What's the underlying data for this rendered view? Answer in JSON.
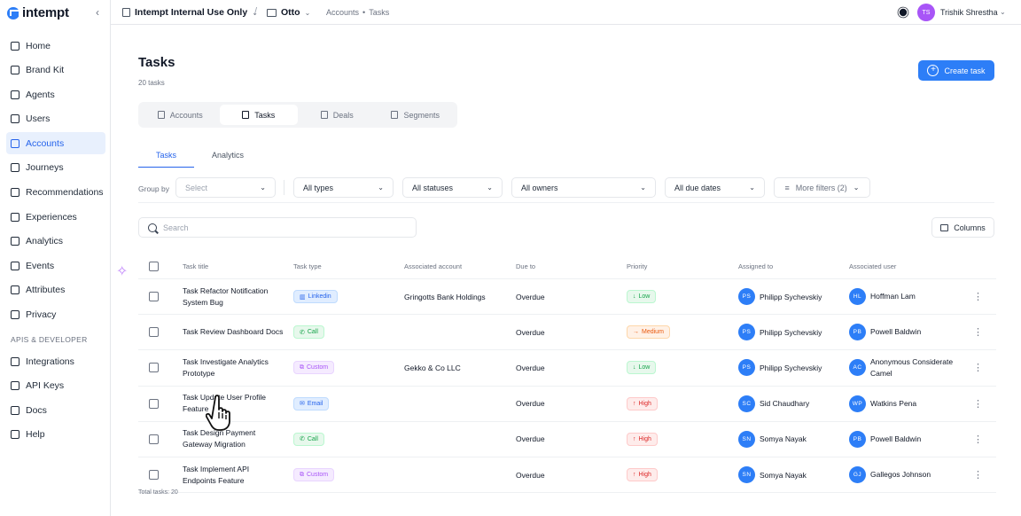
{
  "brand": {
    "name": "intempt"
  },
  "nav": {
    "items": [
      {
        "label": "Home",
        "icon": "home-icon",
        "active": false
      },
      {
        "label": "Brand Kit",
        "icon": "brand-kit-icon",
        "active": false
      },
      {
        "label": "Agents",
        "icon": "agents-icon",
        "active": false
      },
      {
        "label": "Users",
        "icon": "users-icon",
        "active": false
      },
      {
        "label": "Accounts",
        "icon": "accounts-icon",
        "active": true
      },
      {
        "label": "Journeys",
        "icon": "journeys-icon",
        "active": false
      },
      {
        "label": "Recommendations",
        "icon": "recommendations-icon",
        "active": false
      },
      {
        "label": "Experiences",
        "icon": "experiences-icon",
        "active": false
      },
      {
        "label": "Analytics",
        "icon": "analytics-icon",
        "active": false
      },
      {
        "label": "Events",
        "icon": "events-icon",
        "active": false
      },
      {
        "label": "Attributes",
        "icon": "attributes-icon",
        "active": false
      },
      {
        "label": "Privacy",
        "icon": "privacy-icon",
        "active": false
      }
    ],
    "section_label": "APIS & DEVELOPER",
    "dev_items": [
      {
        "label": "Integrations",
        "icon": "integrations-icon"
      },
      {
        "label": "API Keys",
        "icon": "api-keys-icon"
      },
      {
        "label": "Docs",
        "icon": "docs-icon"
      },
      {
        "label": "Help",
        "icon": "help-icon"
      }
    ]
  },
  "topbar": {
    "workspace": "Intempt Internal Use Only",
    "project": "Otto",
    "path": [
      "Accounts",
      "Tasks"
    ],
    "user": {
      "initials": "TS",
      "name": "Trishik Shrestha"
    }
  },
  "page": {
    "title": "Tasks",
    "subtitle": "20 tasks",
    "create_label": "Create task"
  },
  "segments": [
    {
      "label": "Accounts",
      "active": false
    },
    {
      "label": "Tasks",
      "active": true
    },
    {
      "label": "Deals",
      "active": false
    },
    {
      "label": "Segments",
      "active": false
    }
  ],
  "subtabs": [
    {
      "label": "Tasks",
      "active": true
    },
    {
      "label": "Analytics",
      "active": false
    }
  ],
  "filters": {
    "group_by_label": "Group by",
    "group_by_placeholder": "Select",
    "types": "All types",
    "statuses": "All statuses",
    "owners": "All owners",
    "due_dates": "All due dates",
    "more_filters": "More filters (2)"
  },
  "search": {
    "placeholder": "Search"
  },
  "columns_label": "Columns",
  "table": {
    "headers": [
      "Task title",
      "Task type",
      "Associated account",
      "Due to",
      "Priority",
      "Assigned to",
      "Associated user"
    ],
    "rows": [
      {
        "title": "Task Refactor Notification System Bug",
        "type": "Linkedin",
        "type_key": "linkedin",
        "account": "Gringotts Bank Holdings",
        "due": "Overdue",
        "priority": "Low",
        "priority_key": "low",
        "assignee_initials": "PS",
        "assignee": "Philipp Sychevskiy",
        "user_initials": "HL",
        "user": "Hoffman Lam"
      },
      {
        "title": "Task Review Dashboard Docs",
        "type": "Call",
        "type_key": "call",
        "account": "",
        "due": "Overdue",
        "priority": "Medium",
        "priority_key": "medium",
        "assignee_initials": "PS",
        "assignee": "Philipp Sychevskiy",
        "user_initials": "PB",
        "user": "Powell Baldwin"
      },
      {
        "title": "Task Investigate Analytics Prototype",
        "type": "Custom",
        "type_key": "custom",
        "account": "Gekko & Co LLC",
        "due": "Overdue",
        "priority": "Low",
        "priority_key": "low",
        "assignee_initials": "PS",
        "assignee": "Philipp Sychevskiy",
        "user_initials": "AC",
        "user": "Anonymous Considerate Camel"
      },
      {
        "title": "Task Update User Profile Feature",
        "type": "Email",
        "type_key": "email",
        "account": "",
        "due": "Overdue",
        "priority": "High",
        "priority_key": "high",
        "assignee_initials": "SC",
        "assignee": "Sid Chaudhary",
        "user_initials": "WP",
        "user": "Watkins Pena"
      },
      {
        "title": "Task Design Payment Gateway Migration",
        "type": "Call",
        "type_key": "call",
        "account": "",
        "due": "Overdue",
        "priority": "High",
        "priority_key": "high",
        "assignee_initials": "SN",
        "assignee": "Somya Nayak",
        "user_initials": "PB",
        "user": "Powell Baldwin"
      },
      {
        "title": "Task Implement API Endpoints Feature",
        "type": "Custom",
        "type_key": "custom",
        "account": "",
        "due": "Overdue",
        "priority": "High",
        "priority_key": "high",
        "assignee_initials": "SN",
        "assignee": "Somya Nayak",
        "user_initials": "GJ",
        "user": "Gallegos Johnson"
      }
    ]
  },
  "footer": {
    "total": "Total tasks: 20"
  },
  "colors": {
    "accent": "#2d7ef7",
    "active_nav_bg": "#e8f0fd",
    "avatar_purple": "#a855f7"
  }
}
